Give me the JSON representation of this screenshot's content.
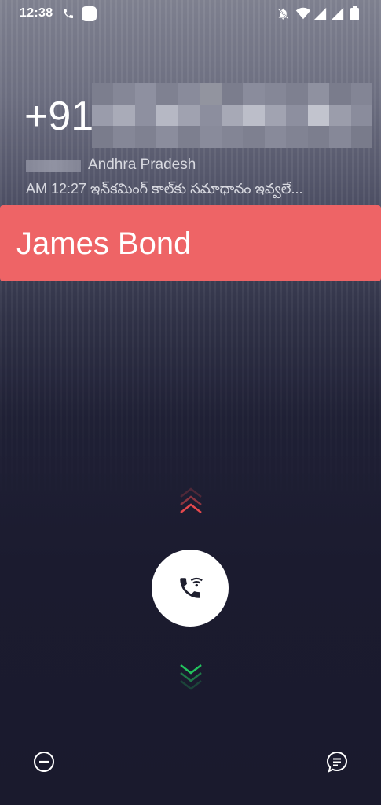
{
  "status_bar": {
    "time": "12:38",
    "icons": [
      "phone-icon",
      "app-notification-icon",
      "mute-icon",
      "wifi-icon",
      "signal-icon",
      "signal-icon",
      "battery-icon"
    ]
  },
  "caller": {
    "number_prefix": "+91",
    "location": "Andhra Pradesh",
    "last_call": "AM 12:27 ఇన్‌కమింగ్ కాల్‌కు సమాధానం ఇవ్వలే..."
  },
  "banner": {
    "name": "James Bond",
    "color": "#ee6466"
  },
  "controls": {
    "answer_icon": "wifi-call-icon",
    "swipe_up_color": "#e5484d",
    "swipe_down_color": "#22c55e",
    "left_icon": "do-not-disturb-icon",
    "right_icon": "message-icon"
  }
}
